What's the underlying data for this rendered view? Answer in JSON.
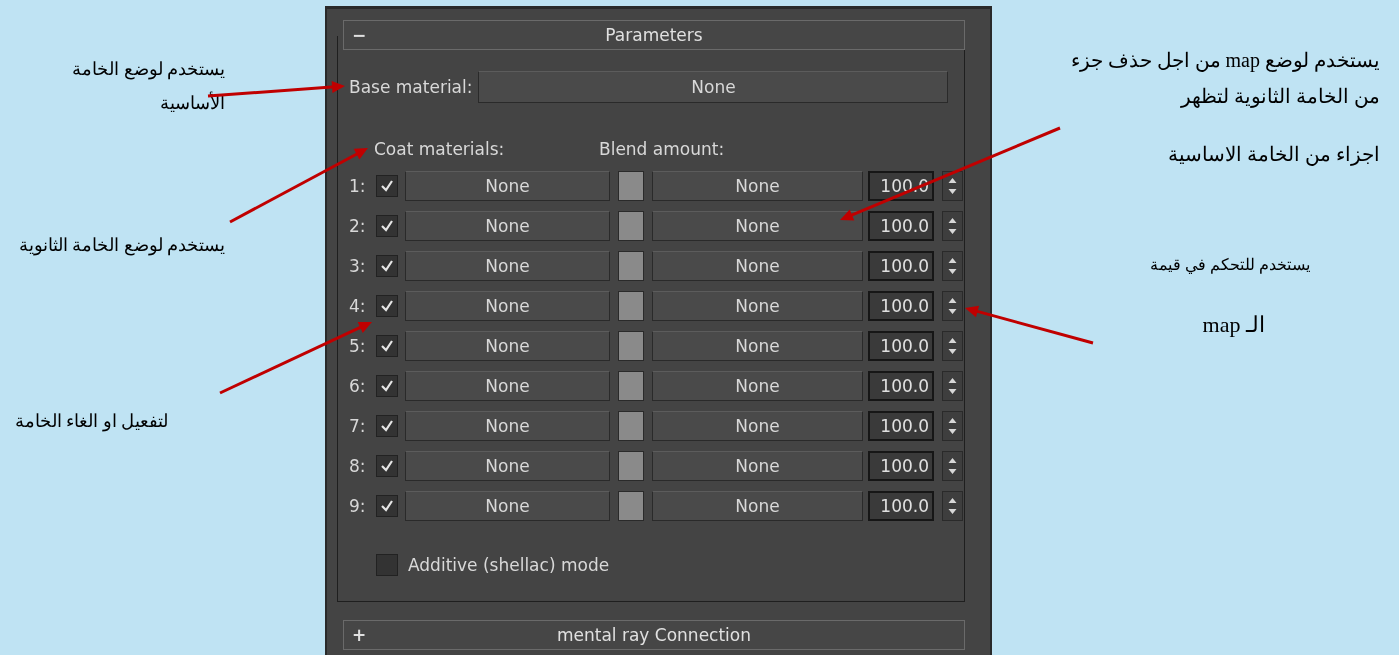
{
  "notes_left": [
    {
      "text": "يستخدم لوضع الخامة"
    },
    {
      "text": "الأساسية"
    },
    {
      "text": "يستخدم لوضع  الخامة الثانوية"
    },
    {
      "text": "لتفعيل او  الغاء  الخامة"
    }
  ],
  "panel": {
    "rollout": {
      "toggle": "−",
      "title": "Parameters"
    },
    "base_material": {
      "label": "Base material:",
      "button": "None"
    },
    "coat_header": "Coat materials:",
    "blend_header": "Blend amount:",
    "rows": [
      {
        "index": "1:",
        "checked": true,
        "material": "None",
        "mask": "None",
        "amount": "100.0"
      },
      {
        "index": "2:",
        "checked": true,
        "material": "None",
        "mask": "None",
        "amount": "100.0"
      },
      {
        "index": "3:",
        "checked": true,
        "material": "None",
        "mask": "None",
        "amount": "100.0"
      },
      {
        "index": "4:",
        "checked": true,
        "material": "None",
        "mask": "None",
        "amount": "100.0"
      },
      {
        "index": "5:",
        "checked": true,
        "material": "None",
        "mask": "None",
        "amount": "100.0"
      },
      {
        "index": "6:",
        "checked": true,
        "material": "None",
        "mask": "None",
        "amount": "100.0"
      },
      {
        "index": "7:",
        "checked": true,
        "material": "None",
        "mask": "None",
        "amount": "100.0"
      },
      {
        "index": "8:",
        "checked": true,
        "material": "None",
        "mask": "None",
        "amount": "100.0"
      },
      {
        "index": "9:",
        "checked": true,
        "material": "None",
        "mask": "None",
        "amount": "100.0"
      }
    ],
    "additive": {
      "label": "Additive (shellac) mode",
      "checked": false
    },
    "rollout_2": {
      "toggle": "+",
      "title": "mental ray Connection"
    }
  },
  "notes_right": [
    {
      "text": "يستخدم لوضع map من  اجل حذف جزء"
    },
    {
      "text": "من الخامة الثانوية لتظهر"
    },
    {
      "text": "اجزاء من الخامة الاساسية"
    },
    {
      "text": "يستخدم للتحكم في قيمة"
    },
    {
      "text": "الـ map"
    }
  ]
}
